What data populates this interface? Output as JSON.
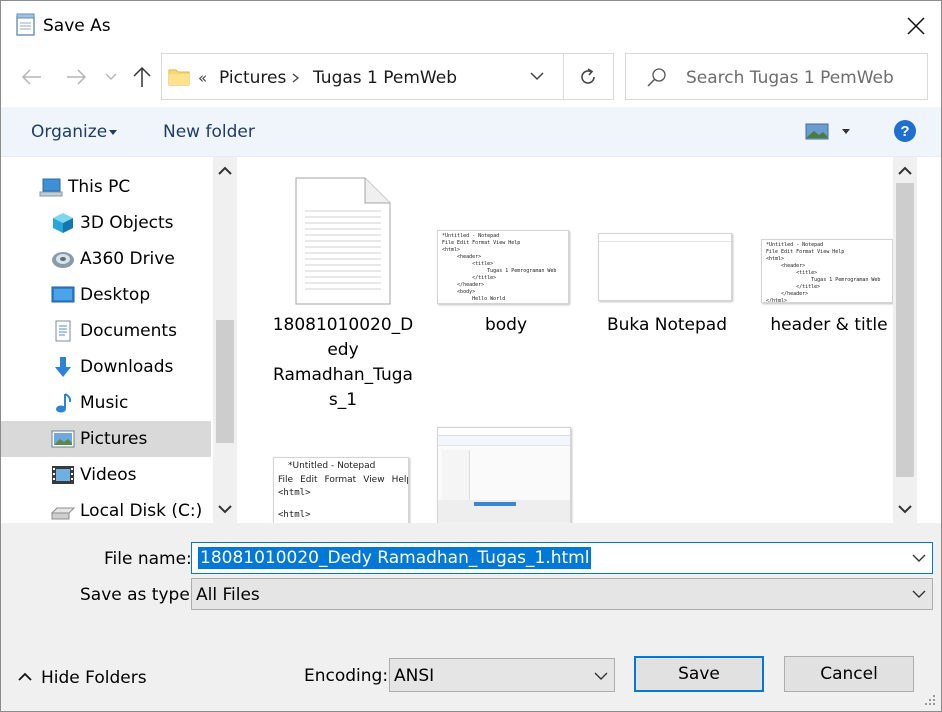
{
  "window": {
    "title": "Save As"
  },
  "nav": {
    "address_prefix": "«",
    "breadcrumbs": [
      "Pictures",
      "Tugas 1 PemWeb"
    ],
    "search_placeholder": "Search Tugas 1 PemWeb"
  },
  "toolbar": {
    "organize": "Organize",
    "new_folder": "New folder"
  },
  "tree": {
    "items": [
      {
        "label": "This PC",
        "icon": "pc-icon"
      },
      {
        "label": "3D Objects",
        "icon": "3d-objects-icon"
      },
      {
        "label": "A360 Drive",
        "icon": "a360-drive-icon"
      },
      {
        "label": "Desktop",
        "icon": "desktop-icon"
      },
      {
        "label": "Documents",
        "icon": "documents-icon"
      },
      {
        "label": "Downloads",
        "icon": "downloads-icon"
      },
      {
        "label": "Music",
        "icon": "music-icon"
      },
      {
        "label": "Pictures",
        "icon": "pictures-icon",
        "selected": true
      },
      {
        "label": "Videos",
        "icon": "videos-icon"
      },
      {
        "label": "Local Disk (C:)",
        "icon": "local-disk-icon"
      }
    ]
  },
  "files": [
    {
      "name": "18081010020_Dedy Ramadhan_Tugas_1",
      "name_lines": [
        "18081010020_D",
        "edy",
        "Ramadhan_Tuga",
        "s_1"
      ],
      "kind": "document"
    },
    {
      "name": "body",
      "kind": "image"
    },
    {
      "name": "Buka Notepad",
      "kind": "image"
    },
    {
      "name": "header & title",
      "kind": "image"
    }
  ],
  "thumbs": {
    "notepad_title": "*Untitled - Notepad",
    "notepad_menu": [
      "File",
      "Edit",
      "Format",
      "View",
      "Help"
    ],
    "notepad_line1": "<html>",
    "notepad_line2": "<html>"
  },
  "bottom": {
    "file_name_label": "File name:",
    "file_name_value": "18081010020_Dedy Ramadhan_Tugas_1.html",
    "save_type_label": "Save as type:",
    "save_type_value": "All Files",
    "hide_folders": "Hide Folders",
    "encoding_label": "Encoding:",
    "encoding_value": "ANSI",
    "save_button": "Save",
    "cancel_button": "Cancel"
  },
  "colors": {
    "accent": "#0078d7",
    "toolbar_bg": "#f0f5fb",
    "panel_bg": "#f0f0f0"
  }
}
